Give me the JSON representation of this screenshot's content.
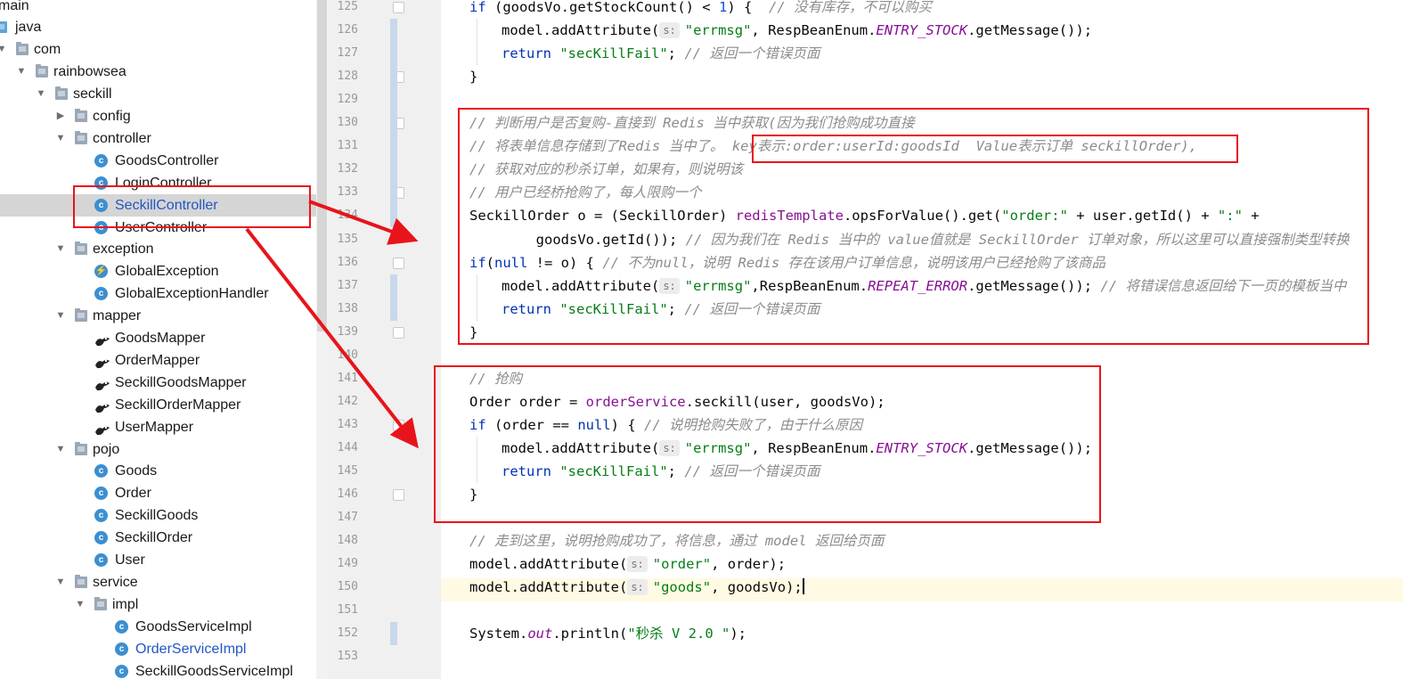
{
  "project_tree": {
    "items": [
      {
        "label": "main",
        "icon": "folder-icon",
        "arrow": ""
      },
      {
        "label": "java",
        "icon": "java-source-folder-icon",
        "arrow": ""
      },
      {
        "label": "com",
        "icon": "package-icon",
        "arrow": "▼"
      },
      {
        "label": "rainbowsea",
        "icon": "package-icon",
        "arrow": "▼"
      },
      {
        "label": "seckill",
        "icon": "package-icon",
        "arrow": "▼"
      },
      {
        "label": "config",
        "icon": "package-icon",
        "arrow": "▶"
      },
      {
        "label": "controller",
        "icon": "package-icon",
        "arrow": "▼"
      },
      {
        "label": "GoodsController",
        "icon": "class-icon",
        "arrow": ""
      },
      {
        "label": "LoginController",
        "icon": "class-icon",
        "arrow": ""
      },
      {
        "label": "SeckillController",
        "icon": "class-icon",
        "arrow": "",
        "selected": true
      },
      {
        "label": "UserController",
        "icon": "class-icon",
        "arrow": ""
      },
      {
        "label": "exception",
        "icon": "package-icon",
        "arrow": "▼"
      },
      {
        "label": "GlobalException",
        "icon": "exception-class-icon",
        "arrow": ""
      },
      {
        "label": "GlobalExceptionHandler",
        "icon": "class-icon",
        "arrow": ""
      },
      {
        "label": "mapper",
        "icon": "package-icon",
        "arrow": "▼"
      },
      {
        "label": "GoodsMapper",
        "icon": "mybatis-mapper-icon",
        "arrow": ""
      },
      {
        "label": "OrderMapper",
        "icon": "mybatis-mapper-icon",
        "arrow": ""
      },
      {
        "label": "SeckillGoodsMapper",
        "icon": "mybatis-mapper-icon",
        "arrow": ""
      },
      {
        "label": "SeckillOrderMapper",
        "icon": "mybatis-mapper-icon",
        "arrow": ""
      },
      {
        "label": "UserMapper",
        "icon": "mybatis-mapper-icon",
        "arrow": ""
      },
      {
        "label": "pojo",
        "icon": "package-icon",
        "arrow": "▼"
      },
      {
        "label": "Goods",
        "icon": "class-icon",
        "arrow": ""
      },
      {
        "label": "Order",
        "icon": "class-icon",
        "arrow": ""
      },
      {
        "label": "SeckillGoods",
        "icon": "class-icon",
        "arrow": ""
      },
      {
        "label": "SeckillOrder",
        "icon": "class-icon",
        "arrow": ""
      },
      {
        "label": "User",
        "icon": "class-icon",
        "arrow": ""
      },
      {
        "label": "service",
        "icon": "package-icon",
        "arrow": "▼"
      },
      {
        "label": "impl",
        "icon": "package-icon",
        "arrow": "▼"
      },
      {
        "label": "GoodsServiceImpl",
        "icon": "class-icon",
        "arrow": ""
      },
      {
        "label": "OrderServiceImpl",
        "icon": "class-icon",
        "arrow": "",
        "modified": true
      },
      {
        "label": "SeckillGoodsServiceImpl",
        "icon": "class-icon",
        "arrow": ""
      }
    ]
  },
  "editor": {
    "current_line": 150,
    "lines": [
      {
        "n": 125,
        "code": [
          [
            "kw",
            "if"
          ],
          [
            "t",
            " (goodsVo.getStockCount() < "
          ],
          [
            "num",
            "1"
          ],
          [
            "t",
            ") {  "
          ],
          [
            "cmt",
            "// 没有库存，不可以购买"
          ]
        ]
      },
      {
        "n": 126,
        "code": [
          [
            "t",
            "model.addAttribute("
          ],
          [
            "hint",
            "s:"
          ],
          [
            "str",
            "\"errmsg\""
          ],
          [
            "t",
            ", RespBeanEnum."
          ],
          [
            "fld",
            "ENTRY_STOCK"
          ],
          [
            "t",
            ".getMessage());"
          ]
        ]
      },
      {
        "n": 127,
        "code": [
          [
            "kw",
            "return"
          ],
          [
            "t",
            " "
          ],
          [
            "str",
            "\"secKillFail\""
          ],
          [
            "t",
            "; "
          ],
          [
            "cmt",
            "// 返回一个错误页面"
          ]
        ]
      },
      {
        "n": 128,
        "code": [
          [
            "t",
            "}"
          ]
        ]
      },
      {
        "n": 129,
        "code": []
      },
      {
        "n": 130,
        "code": [
          [
            "cmt",
            "// 判断用户是否复购-直接到 Redis 当中获取(因为我们抢购成功直接"
          ]
        ]
      },
      {
        "n": 131,
        "code": [
          [
            "cmt",
            "// 将表单信息存储到了Redis 当中了。 key表示:order:userId:goodsId  Value表示订单 seckillOrder),"
          ]
        ]
      },
      {
        "n": 132,
        "code": [
          [
            "cmt",
            "// 获取对应的秒杀订单，如果有，则说明该"
          ]
        ]
      },
      {
        "n": 133,
        "code": [
          [
            "cmt",
            "// 用户已经桥抢购了，每人限购一个"
          ]
        ]
      },
      {
        "n": 134,
        "code": [
          [
            "t",
            "SeckillOrder o = (SeckillOrder) "
          ],
          [
            "ifld",
            "redisTemplate"
          ],
          [
            "t",
            ".opsForValue().get("
          ],
          [
            "str",
            "\"order:\""
          ],
          [
            "t",
            " + user.getId() + "
          ],
          [
            "str",
            "\":\""
          ],
          [
            "t",
            " +"
          ]
        ]
      },
      {
        "n": 135,
        "code": [
          [
            "t",
            "        goodsVo.getId()); "
          ],
          [
            "cmt",
            "// 因为我们在 Redis 当中的 value值就是 SeckillOrder 订单对象，所以这里可以直接强制类型转换"
          ]
        ]
      },
      {
        "n": 136,
        "code": [
          [
            "kw",
            "if"
          ],
          [
            "t",
            "("
          ],
          [
            "kw",
            "null"
          ],
          [
            "t",
            " != o) { "
          ],
          [
            "cmt",
            "// 不为null，说明 Redis 存在该用户订单信息，说明该用户已经抢购了该商品"
          ]
        ]
      },
      {
        "n": 137,
        "code": [
          [
            "t",
            "model.addAttribute("
          ],
          [
            "hint",
            "s:"
          ],
          [
            "str",
            "\"errmsg\""
          ],
          [
            "t",
            ",RespBeanEnum."
          ],
          [
            "fld",
            "REPEAT_ERROR"
          ],
          [
            "t",
            ".getMessage()); "
          ],
          [
            "cmt",
            "// 将错误信息返回给下一页的模板当中"
          ]
        ]
      },
      {
        "n": 138,
        "code": [
          [
            "kw",
            "return"
          ],
          [
            "t",
            " "
          ],
          [
            "str",
            "\"secKillFail\""
          ],
          [
            "t",
            "; "
          ],
          [
            "cmt",
            "// 返回一个错误页面"
          ]
        ]
      },
      {
        "n": 139,
        "code": [
          [
            "t",
            "}"
          ]
        ]
      },
      {
        "n": 140,
        "code": []
      },
      {
        "n": 141,
        "code": [
          [
            "cmt",
            "// 抢购"
          ]
        ]
      },
      {
        "n": 142,
        "code": [
          [
            "t",
            "Order order = "
          ],
          [
            "ifld",
            "orderService"
          ],
          [
            "t",
            ".seckill(user, goodsVo);"
          ]
        ]
      },
      {
        "n": 143,
        "code": [
          [
            "kw",
            "if"
          ],
          [
            "t",
            " (order == "
          ],
          [
            "kw",
            "null"
          ],
          [
            "t",
            ") { "
          ],
          [
            "cmt",
            "// 说明抢购失败了，由于什么原因"
          ]
        ]
      },
      {
        "n": 144,
        "code": [
          [
            "t",
            "model.addAttribute("
          ],
          [
            "hint",
            "s:"
          ],
          [
            "str",
            "\"errmsg\""
          ],
          [
            "t",
            ", RespBeanEnum."
          ],
          [
            "fld",
            "ENTRY_STOCK"
          ],
          [
            "t",
            ".getMessage());"
          ]
        ]
      },
      {
        "n": 145,
        "code": [
          [
            "kw",
            "return"
          ],
          [
            "t",
            " "
          ],
          [
            "str",
            "\"secKillFail\""
          ],
          [
            "t",
            "; "
          ],
          [
            "cmt",
            "// 返回一个错误页面"
          ]
        ]
      },
      {
        "n": 146,
        "code": [
          [
            "t",
            "}"
          ]
        ]
      },
      {
        "n": 147,
        "code": []
      },
      {
        "n": 148,
        "code": [
          [
            "cmt",
            "// 走到这里，说明抢购成功了，将信息，通过 model 返回给页面"
          ]
        ]
      },
      {
        "n": 149,
        "code": [
          [
            "t",
            "model.addAttribute("
          ],
          [
            "hint",
            "s:"
          ],
          [
            "str",
            "\"order\""
          ],
          [
            "t",
            ", order);"
          ]
        ]
      },
      {
        "n": 150,
        "code": [
          [
            "t",
            "model.addAttribute("
          ],
          [
            "hint",
            "s:"
          ],
          [
            "str",
            "\"goods\""
          ],
          [
            "t",
            ", goodsVo);"
          ],
          [
            "caret",
            ""
          ]
        ]
      },
      {
        "n": 151,
        "code": []
      },
      {
        "n": 152,
        "code": [
          [
            "t",
            "System."
          ],
          [
            "fld",
            "out"
          ],
          [
            "t",
            ".println("
          ],
          [
            "str",
            "\"秒杀 V 2.0 \""
          ],
          [
            "t",
            ");"
          ]
        ]
      },
      {
        "n": 153,
        "code": []
      }
    ]
  },
  "annotations": {
    "highlight_color": "#e8141b",
    "boxes": [
      "repeat-purchase-check-box",
      "redis-key-note-box",
      "seckill-purchase-box",
      "selected-file-box"
    ]
  }
}
